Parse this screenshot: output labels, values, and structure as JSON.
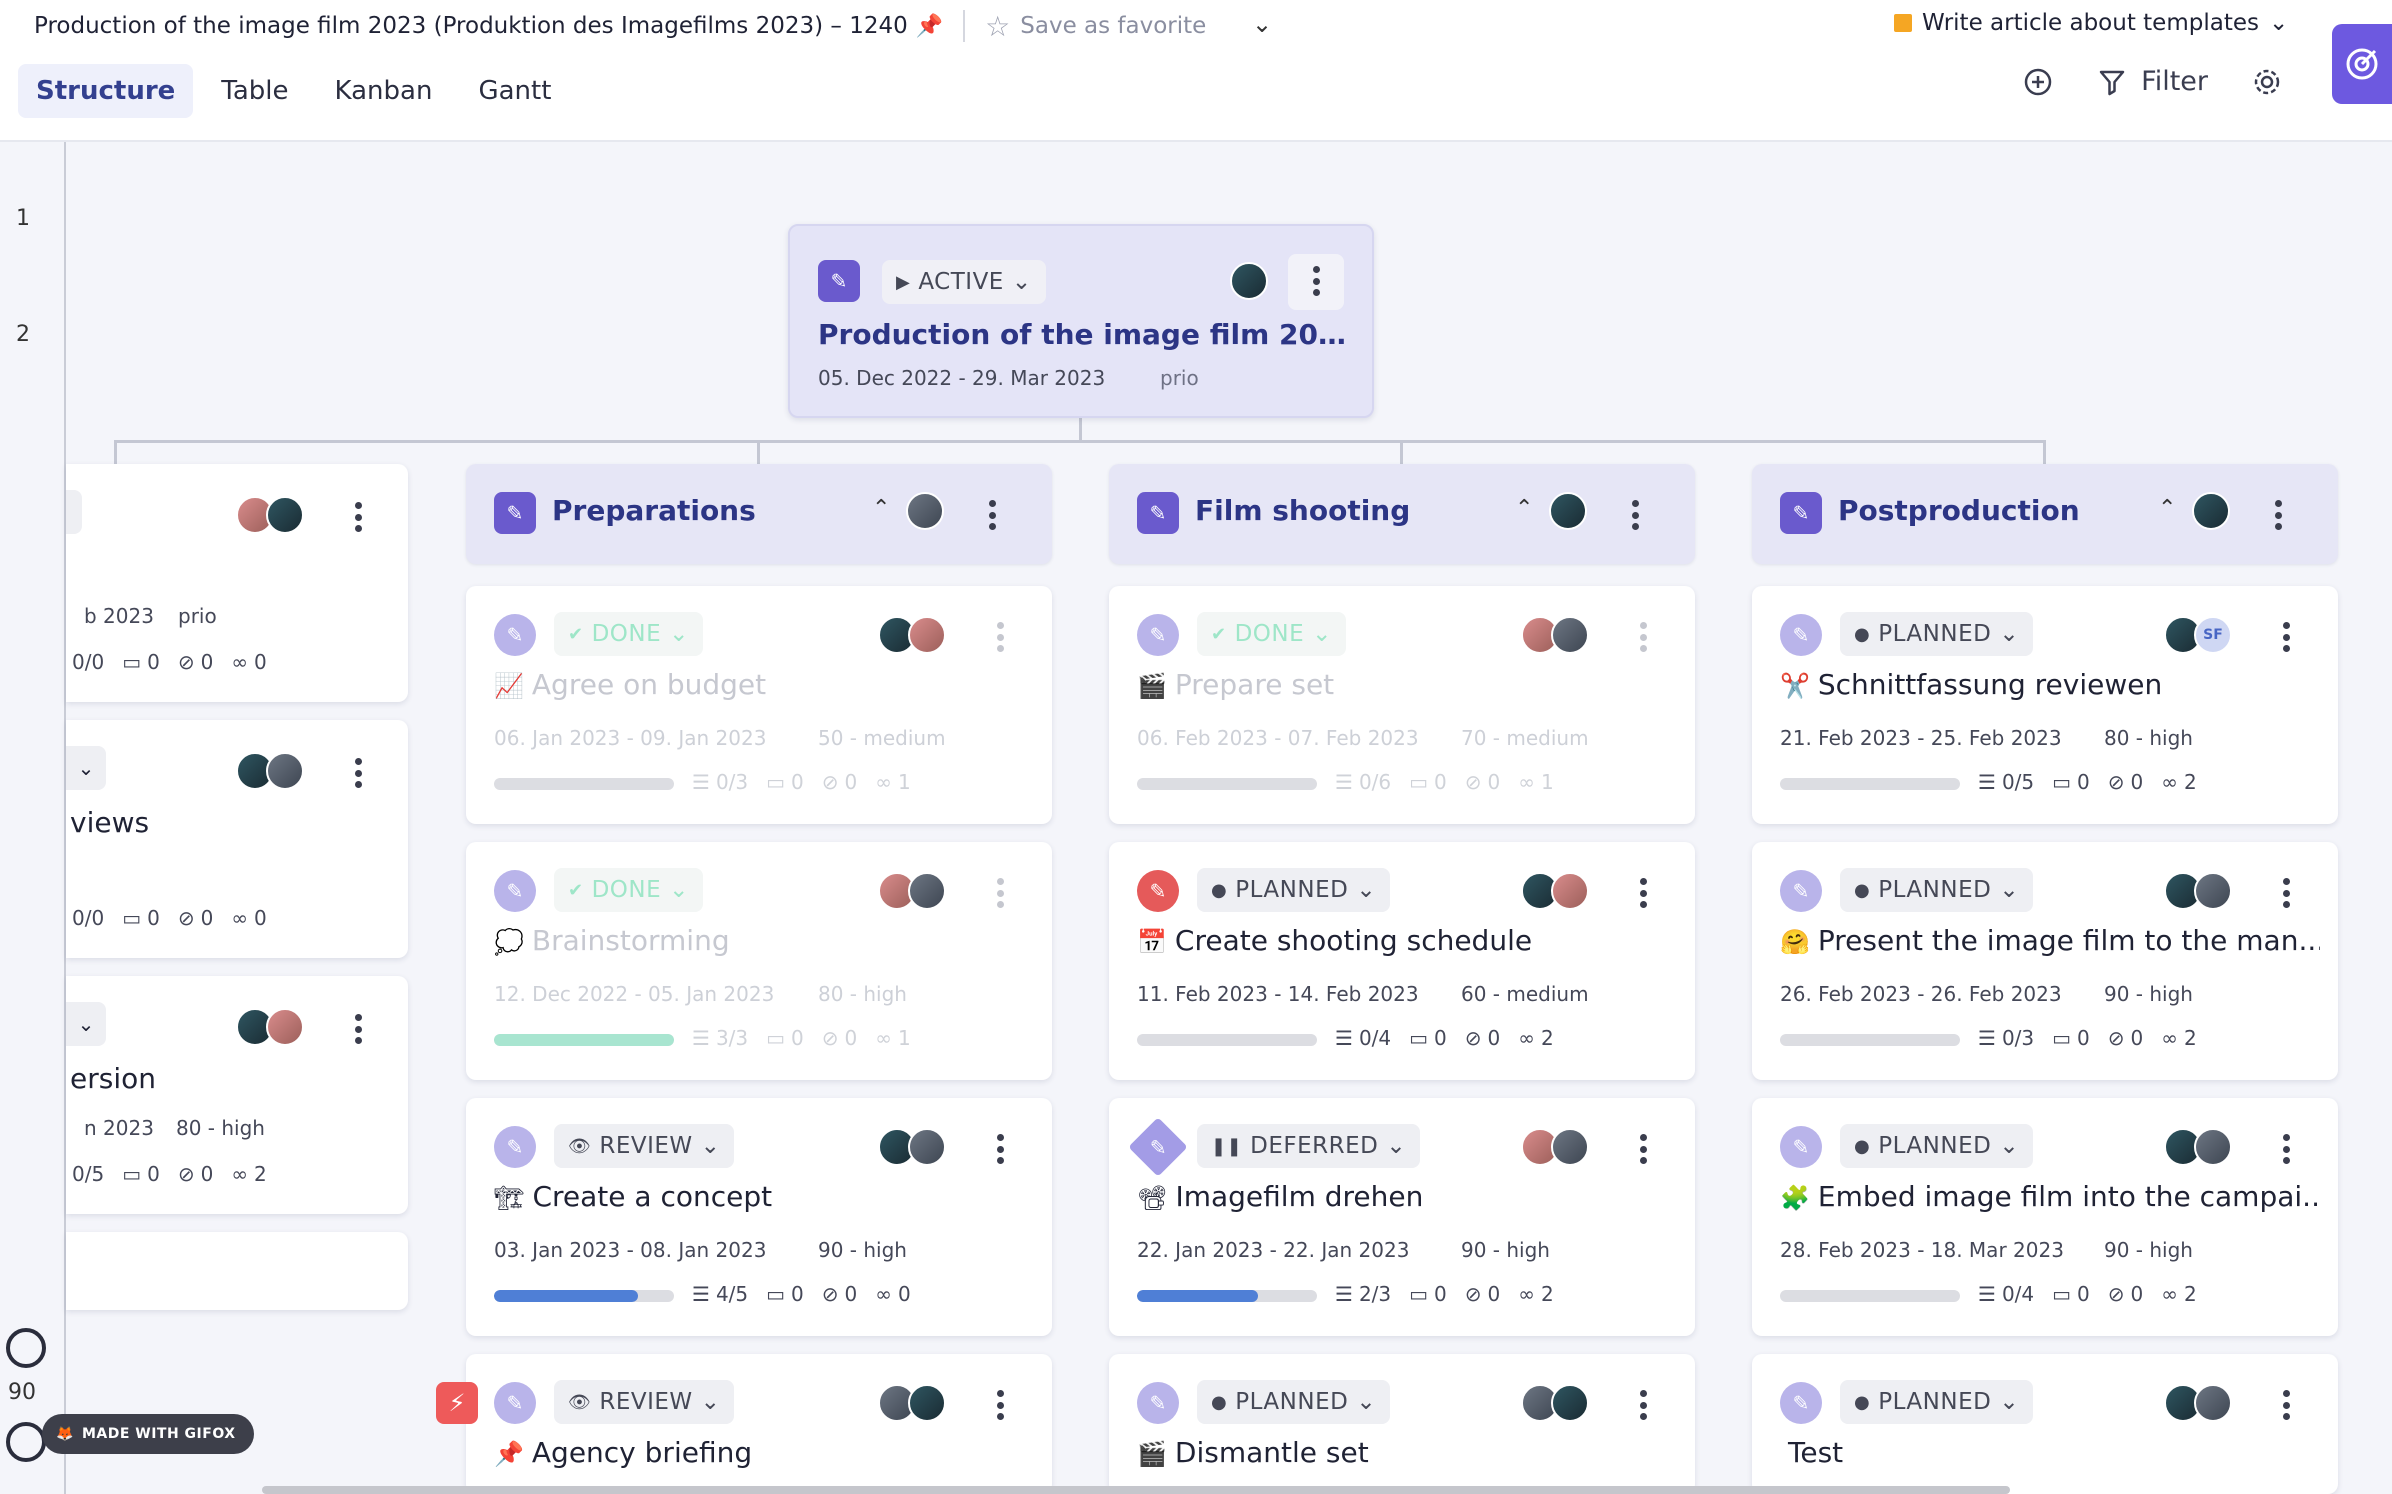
{
  "header": {
    "project_title": "Production of the image film 2023 (Produktion des Imagefilms 2023) – 1240",
    "favorite_label": "Save as favorite",
    "task_selector": "Write article about templates",
    "tabs": [
      "Structure",
      "Table",
      "Kanban",
      "Gantt"
    ],
    "active_tab": "Structure",
    "filter_label": "Filter"
  },
  "ruler": {
    "levels": [
      "1",
      "2"
    ],
    "zoom": "90"
  },
  "gifox": "MADE WITH GIFOX",
  "root": {
    "status": "ACTIVE",
    "title": "Production of the image film 2023 (Pr...",
    "dates": "05. Dec 2022 - 29. Mar 2023",
    "priority": "prio"
  },
  "groups": [
    {
      "title": "Preparations"
    },
    {
      "title": "Film shooting"
    },
    {
      "title": "Postproduction"
    }
  ],
  "left_partial": [
    {
      "date": "b 2023",
      "prio": "prio",
      "tasks": "0/0",
      "comments": "0",
      "attach": "0",
      "links": "0"
    },
    {
      "title": "views",
      "tasks": "0/0",
      "comments": "0",
      "attach": "0",
      "links": "0"
    },
    {
      "title": "ersion",
      "date": "n 2023",
      "prio": "80 - high",
      "tasks": "0/5",
      "comments": "0",
      "attach": "0",
      "links": "2"
    }
  ],
  "cards": {
    "prep": [
      {
        "status": "DONE",
        "emoji": "📈",
        "title": "Agree on budget",
        "dates": "06. Jan 2023 - 09. Jan 2023",
        "prio": "50 - medium",
        "progress": 0,
        "tasks": "0/3",
        "comments": "0",
        "attach": "0",
        "links": "1"
      },
      {
        "status": "DONE",
        "emoji": "💭",
        "title": "Brainstorming",
        "dates": "12. Dec 2022 - 05. Jan 2023",
        "prio": "80 - high",
        "progress": 100,
        "tasks": "3/3",
        "comments": "0",
        "attach": "0",
        "links": "1"
      },
      {
        "status": "REVIEW",
        "emoji": "🏗",
        "title": "Create a concept",
        "dates": "03. Jan 2023 - 08. Jan 2023",
        "prio": "90 - high",
        "progress": 80,
        "tasks": "4/5",
        "comments": "0",
        "attach": "0",
        "links": "0"
      },
      {
        "status": "REVIEW",
        "emoji": "📌",
        "title": "Agency briefing"
      }
    ],
    "film": [
      {
        "status": "DONE",
        "emoji": "🎬",
        "title": "Prepare set",
        "dates": "06. Feb 2023 - 07. Feb 2023",
        "prio": "70 - medium",
        "progress": 0,
        "tasks": "0/6",
        "comments": "0",
        "attach": "0",
        "links": "1"
      },
      {
        "status": "PLANNED",
        "emoji": "📅",
        "title": "Create shooting schedule",
        "dates": "11. Feb 2023 - 14. Feb 2023",
        "prio": "60 - medium",
        "progress": 0,
        "tasks": "0/4",
        "comments": "0",
        "attach": "0",
        "links": "2"
      },
      {
        "status": "DEFERRED",
        "emoji": "📽",
        "title": "Imagefilm drehen",
        "dates": "22. Jan 2023 - 22. Jan 2023",
        "prio": "90 - high",
        "progress": 67,
        "tasks": "2/3",
        "comments": "0",
        "attach": "0",
        "links": "2"
      },
      {
        "status": "PLANNED",
        "emoji": "🎬",
        "title": "Dismantle set"
      }
    ],
    "post": [
      {
        "status": "PLANNED",
        "emoji": "✂️",
        "title": "Schnittfassung reviewen",
        "dates": "21. Feb 2023 - 25. Feb 2023",
        "prio": "80 - high",
        "progress": 0,
        "tasks": "0/5",
        "comments": "0",
        "attach": "0",
        "links": "2"
      },
      {
        "status": "PLANNED",
        "emoji": "🤗",
        "title": "Present the image film to the man...",
        "dates": "26. Feb 2023 - 26. Feb 2023",
        "prio": "90 - high",
        "progress": 0,
        "tasks": "0/3",
        "comments": "0",
        "attach": "0",
        "links": "2"
      },
      {
        "status": "PLANNED",
        "emoji": "🧩",
        "title": "Embed image film into the campai...",
        "dates": "28. Feb 2023 - 18. Mar 2023",
        "prio": "90 - high",
        "progress": 0,
        "tasks": "0/4",
        "comments": "0",
        "attach": "0",
        "links": "2"
      },
      {
        "status": "PLANNED",
        "emoji": "",
        "title": "Test"
      }
    ]
  }
}
